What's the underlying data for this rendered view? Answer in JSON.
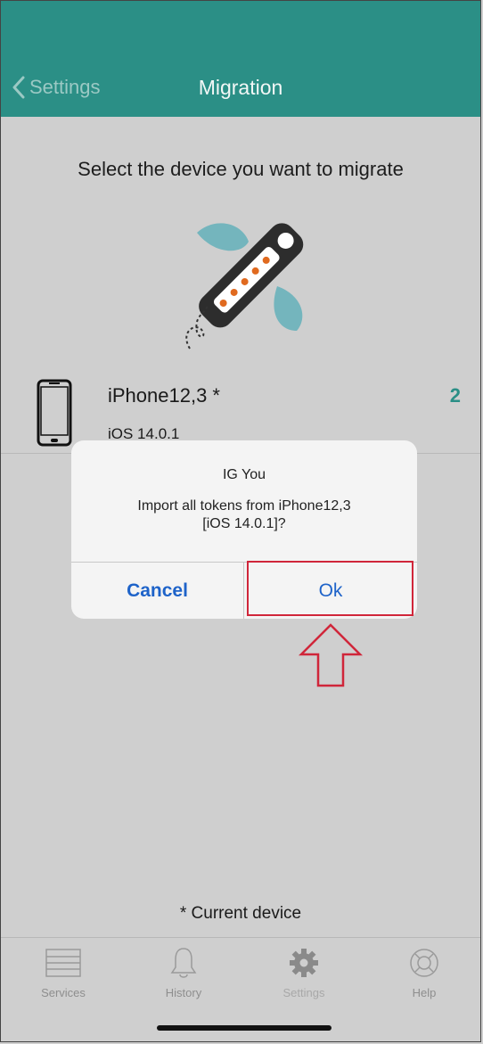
{
  "header": {
    "back_label": "Settings",
    "title": "Migration",
    "color": "#2b8f86"
  },
  "main": {
    "subtitle": "Select the device you want to migrate",
    "device": {
      "name": "iPhone12,3 *",
      "os": "iOS 14.0.1",
      "count": "2",
      "icon": "smartphone-icon"
    },
    "footnote": "* Current device"
  },
  "dialog": {
    "title": "IG You",
    "message_line1": "Import all tokens from iPhone12,3",
    "message_line2": "[iOS 14.0.1]?",
    "cancel_label": "Cancel",
    "ok_label": "Ok",
    "button_color": "#1e63c9"
  },
  "annotation": {
    "highlight_color": "#d0263a"
  },
  "tabbar": {
    "items": [
      {
        "label": "Services",
        "icon": "list-icon"
      },
      {
        "label": "History",
        "icon": "bell-icon"
      },
      {
        "label": "Settings",
        "icon": "gear-icon",
        "active": true
      },
      {
        "label": "Help",
        "icon": "lifebuoy-icon"
      }
    ]
  }
}
